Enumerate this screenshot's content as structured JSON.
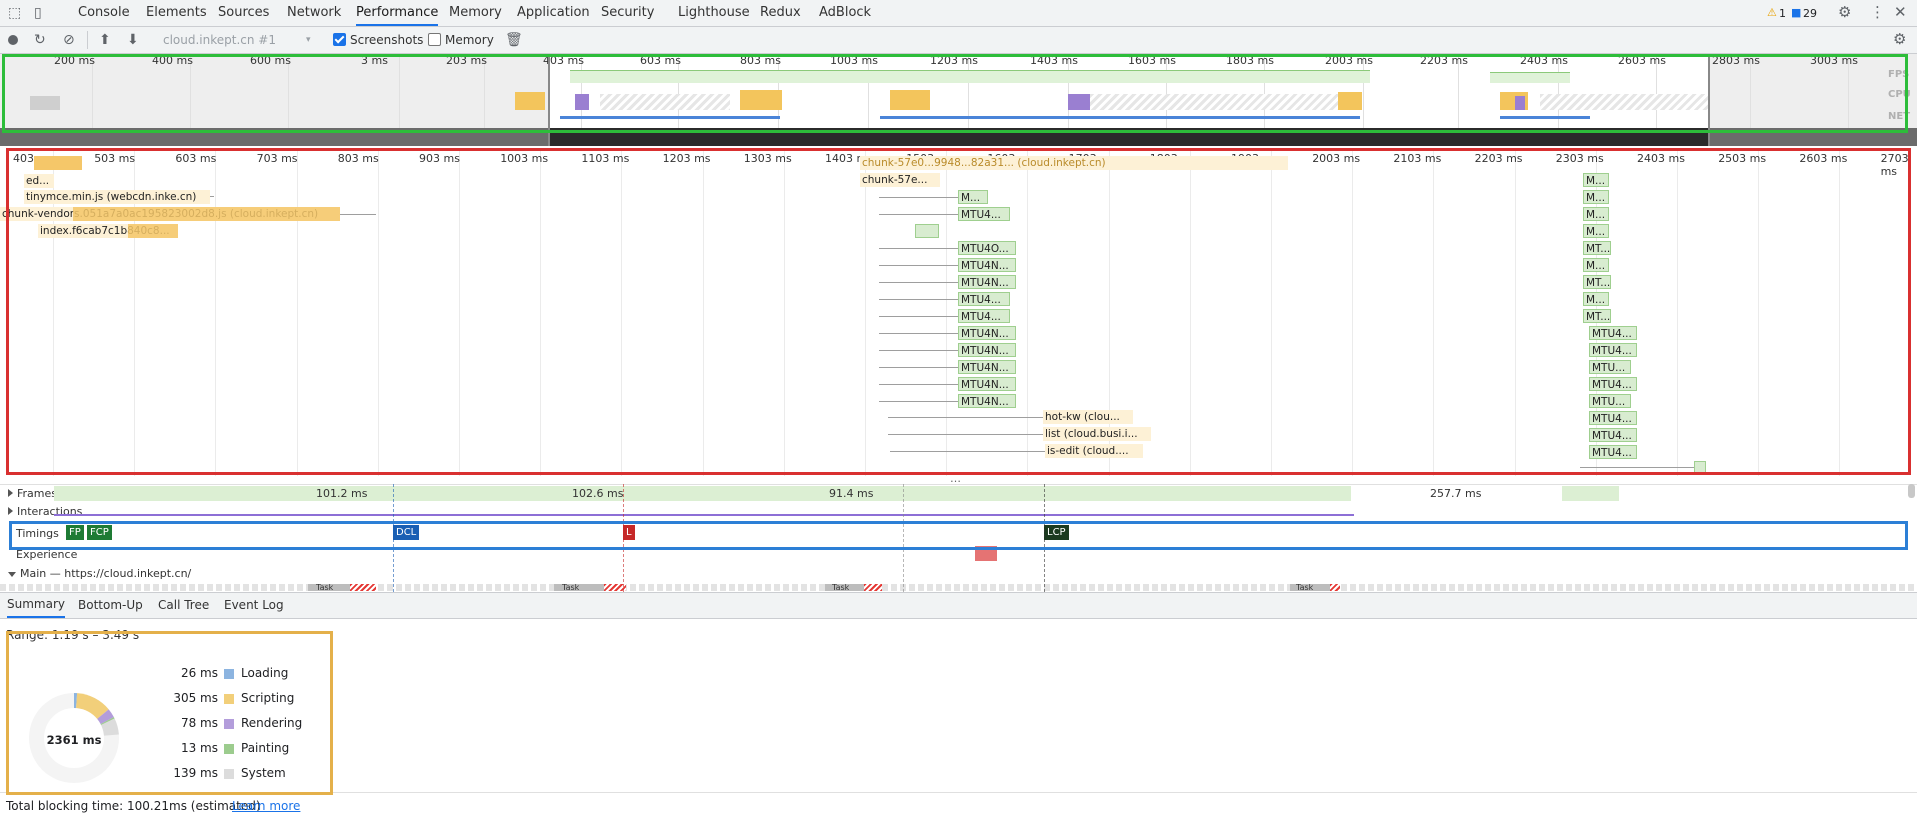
{
  "tabs": [
    "Console",
    "Elements",
    "Sources",
    "Network",
    "Performance",
    "Memory",
    "Application",
    "Security",
    "Lighthouse",
    "Redux",
    "AdBlock"
  ],
  "status": {
    "warnings": "1",
    "messages": "29"
  },
  "toolbar": {
    "profile": "cloud.inkept.cn #1",
    "screenshots_label": "Screenshots",
    "screenshots_checked": true,
    "memory_label": "Memory",
    "memory_checked": false
  },
  "overview": {
    "ticks": [
      "200 ms",
      "400 ms",
      "600 ms",
      "3 ms",
      "203 ms",
      "403 ms",
      "603 ms",
      "803 ms",
      "1003 ms",
      "1203 ms",
      "1403 ms",
      "1603 ms",
      "1803 ms",
      "2003 ms",
      "2203 ms",
      "2403 ms",
      "2603 ms",
      "2803 ms",
      "3003 ms"
    ],
    "side_labels": [
      "FPS",
      "CPU",
      "NET"
    ]
  },
  "flame": {
    "ticks": [
      "403 ms",
      "503 ms",
      "603 ms",
      "703 ms",
      "803 ms",
      "903 ms",
      "1003 ms",
      "1103 ms",
      "1203 ms",
      "1303 ms",
      "1403 ms",
      "1503 ms",
      "1603 ms",
      "1703 ms",
      "1803 ms",
      "1903 ms",
      "2003 ms",
      "2103 ms",
      "2203 ms",
      "2303 ms",
      "2403 ms",
      "2503 ms",
      "2603 ms",
      "2703 ms"
    ],
    "left_requests": [
      "ed...",
      "tinymce.min.js (webcdn.inke.cn)",
      "chunk-vendors.051a7a0ac195823002d8.js (cloud.inkept.cn)",
      "index.f6cab7c1b840c8..."
    ],
    "top_bar_label": "chunk-57e0...9948...82a31... (cloud.inkept.cn)",
    "chunk_label": "chunk-57e...",
    "mid_requests": [
      "M...",
      "MTU4...",
      "MTU4O...",
      "MTU4N...",
      "MTU4N...",
      "MTU4...",
      "MTU4...",
      "MTU4N...",
      "MTU4N...",
      "MTU4N...",
      "MTU4N...",
      "MTU4N..."
    ],
    "api_requests": [
      "hot-kw (clou...",
      "list (cloud.busi.i...",
      "is-edit (cloud...."
    ],
    "right_requests": [
      "M...",
      "M...",
      "M...",
      "M...",
      "MT...",
      "M...",
      "MT...",
      "M...",
      "MT...",
      "MTU4...",
      "MTU4...",
      "MTU...",
      "MTU4...",
      "MTU...",
      "MTU4...",
      "MTU4...",
      "MTU4..."
    ]
  },
  "frames": {
    "label": "Frames",
    "durations": [
      "101.2 ms",
      "102.6 ms",
      "91.4 ms",
      "257.7 ms"
    ]
  },
  "interactions": {
    "label": "Interactions"
  },
  "timings": {
    "label": "Timings",
    "markers": [
      "FP",
      "FCP",
      "DCL",
      "L",
      "LCP"
    ]
  },
  "experience": {
    "label": "Experience"
  },
  "main": {
    "label": "Main — https://cloud.inkept.cn/",
    "task_label": "Task"
  },
  "bottom_tabs": [
    "Summary",
    "Bottom-Up",
    "Call Tree",
    "Event Log"
  ],
  "summary": {
    "range": "Range: 1.19 s – 3.49 s",
    "total": "2361 ms",
    "items": [
      {
        "value": "26 ms",
        "label": "Loading",
        "color": "#8cb4e0"
      },
      {
        "value": "305 ms",
        "label": "Scripting",
        "color": "#f2cf7a"
      },
      {
        "value": "78 ms",
        "label": "Rendering",
        "color": "#b39ddb"
      },
      {
        "value": "13 ms",
        "label": "Painting",
        "color": "#9ccc8e"
      },
      {
        "value": "139 ms",
        "label": "System",
        "color": "#dcdcdc"
      }
    ]
  },
  "footer": {
    "text": "Total blocking time: 100.21ms (estimated)",
    "link": "Learn more"
  },
  "highlight_colors": {
    "overview": "#2dbd3a",
    "flame": "#d93030",
    "timings": "#2c7fd6",
    "summary": "#e4b04a"
  }
}
